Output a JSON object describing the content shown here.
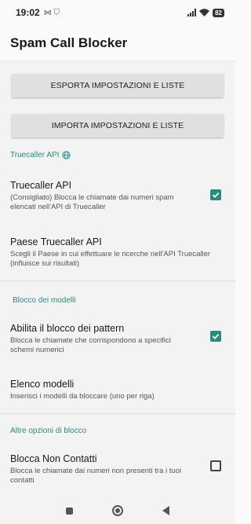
{
  "status_bar": {
    "time": "19:02",
    "notification_icons": "⋈ ⛉",
    "battery": "82"
  },
  "app_bar": {
    "title": "Spam Call Blocker"
  },
  "actions": {
    "export_label": "ESPORTA IMPOSTAZIONI E LISTE",
    "import_label": "IMPORTA IMPOSTAZIONI E LISTE"
  },
  "sections": {
    "truecaller": {
      "header": "Truecaller API",
      "api_pref": {
        "title": "Truecaller API",
        "summary": "(Consigliato) Blocca le chiamate dai numeri spam elencati nell'API di Truecaller",
        "checked": true
      },
      "country_pref": {
        "title": "Paese Truecaller API",
        "summary": "Scegli il Paese in cui effettuare le ricerche nell'API Truecaller (influisce sui risultati)"
      }
    },
    "patterns": {
      "header": "Blocco dei modelli",
      "enable_pref": {
        "title": "Abilita il blocco dei pattern",
        "summary": "Blocca le chiamate che corrispondono a specifici schemi numerici",
        "checked": true
      },
      "list_pref": {
        "title": "Elenco modelli",
        "summary": "Inserisci i modelli da bloccare (uno per riga)"
      }
    },
    "other": {
      "header": "Altre opzioni di blocco",
      "noncontacts_pref": {
        "title": "Blocca Non Contatti",
        "summary": "Blocca le chiamate dai numeri non presenti tra i tuoi contatti",
        "checked": false
      }
    }
  },
  "colors": {
    "accent": "#2a8a7e",
    "button_bg": "#e0e0e0"
  }
}
